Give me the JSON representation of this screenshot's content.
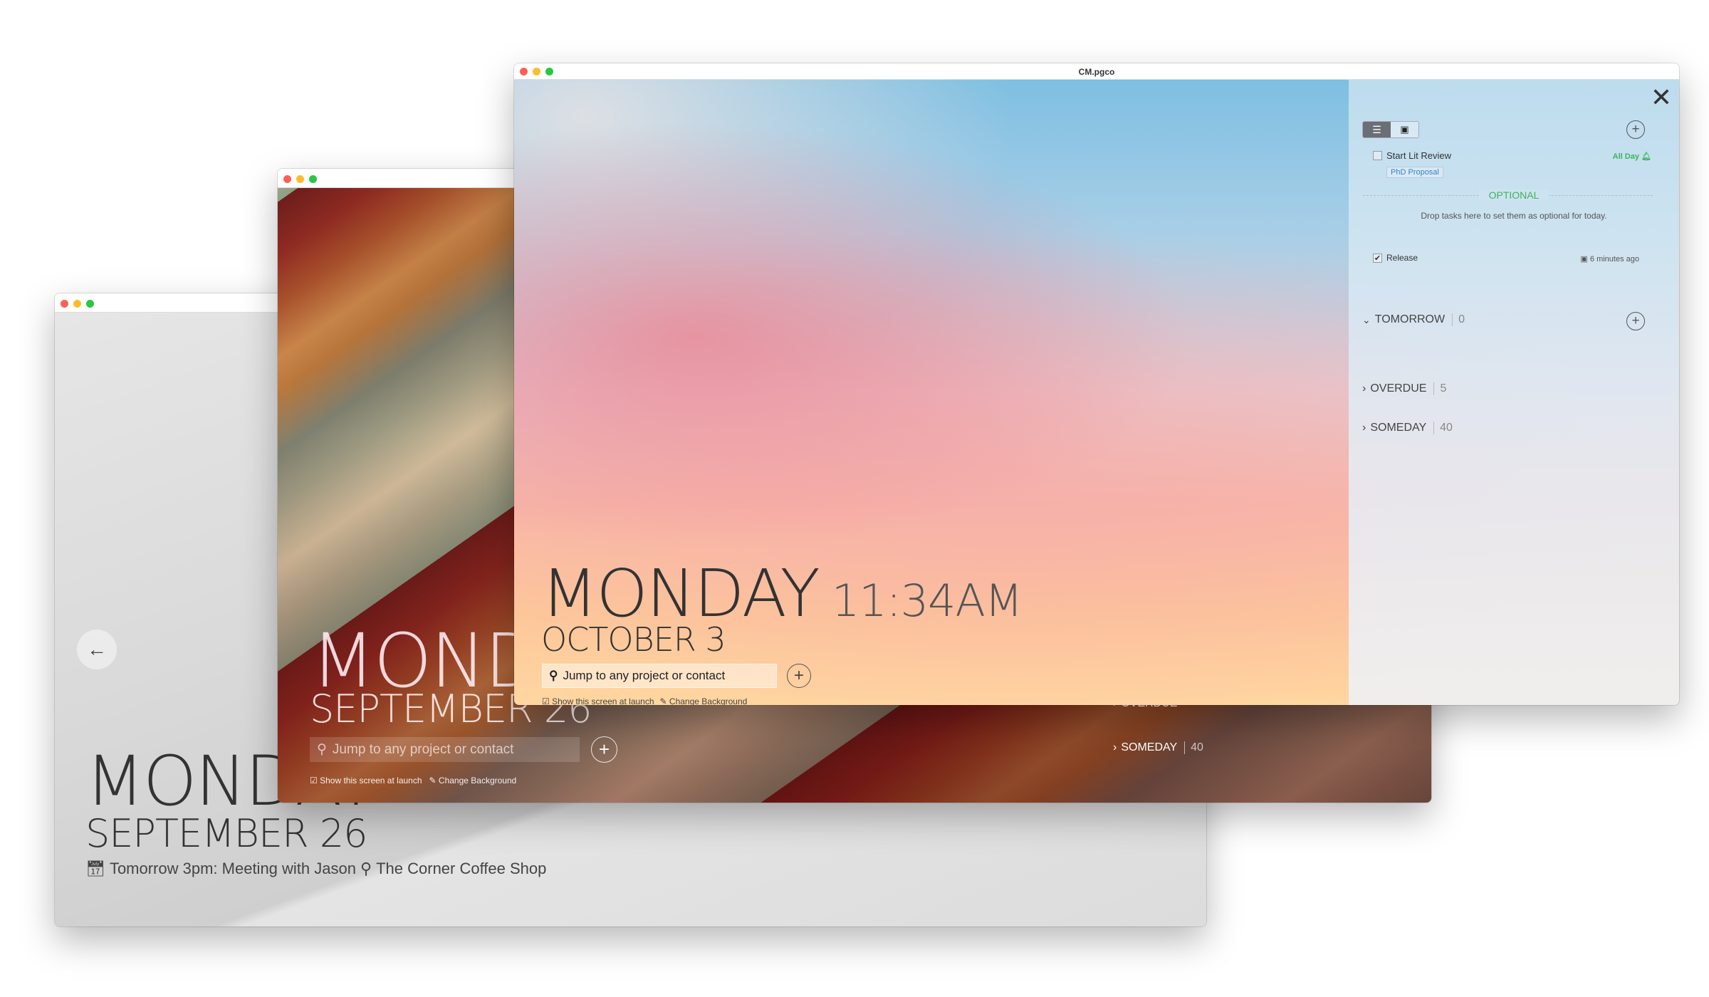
{
  "colors": {
    "close": "#fe5f57",
    "minimize": "#febc2e",
    "zoom": "#28c840",
    "accent_green": "#3cb55a",
    "tag_blue": "#3a7fc4"
  },
  "back_window": {
    "day": "MONDAY",
    "date": "SEPTEMBER 26",
    "event": {
      "icon": "calendar-icon",
      "text": "Tomorrow 3pm: Meeting with Jason",
      "location_icon": "map-marker-icon",
      "location": "The Corner Coffee Shop"
    },
    "back_icon": "arrow-left-icon"
  },
  "middle_window": {
    "day": "MONDAY",
    "date": "SEPTEMBER 26",
    "search_placeholder": "Jump to any project or contact",
    "show_at_launch": "Show this screen at launch",
    "change_background": "Change Background",
    "sections": [
      {
        "label": "OVERDUE"
      },
      {
        "label": "SOMEDAY",
        "count": "40"
      }
    ]
  },
  "front_window": {
    "title": "CM.pgco",
    "day": "MONDAY",
    "time": "11:34AM",
    "date": "OCTOBER 3",
    "search_placeholder": "Jump to any project or contact",
    "show_at_launch": "Show this screen at launch",
    "change_background": "Change Background",
    "panel": {
      "view_toggle": [
        {
          "icon": "list-icon",
          "active": true
        },
        {
          "icon": "calendar-icon",
          "active": false
        }
      ],
      "tasks": [
        {
          "title": "Start Lit Review",
          "checked": false,
          "tag": "PhD Proposal",
          "when": "All Day"
        }
      ],
      "optional": {
        "label": "OPTIONAL",
        "hint": "Drop tasks here to set them as optional for today."
      },
      "completed": [
        {
          "title": "Release",
          "checked": true,
          "when": "6 minutes ago"
        }
      ],
      "sections": [
        {
          "label": "TOMORROW",
          "count": "0",
          "expanded": true
        },
        {
          "label": "OVERDUE",
          "count": "5",
          "expanded": false
        },
        {
          "label": "SOMEDAY",
          "count": "40",
          "expanded": false
        }
      ]
    }
  }
}
